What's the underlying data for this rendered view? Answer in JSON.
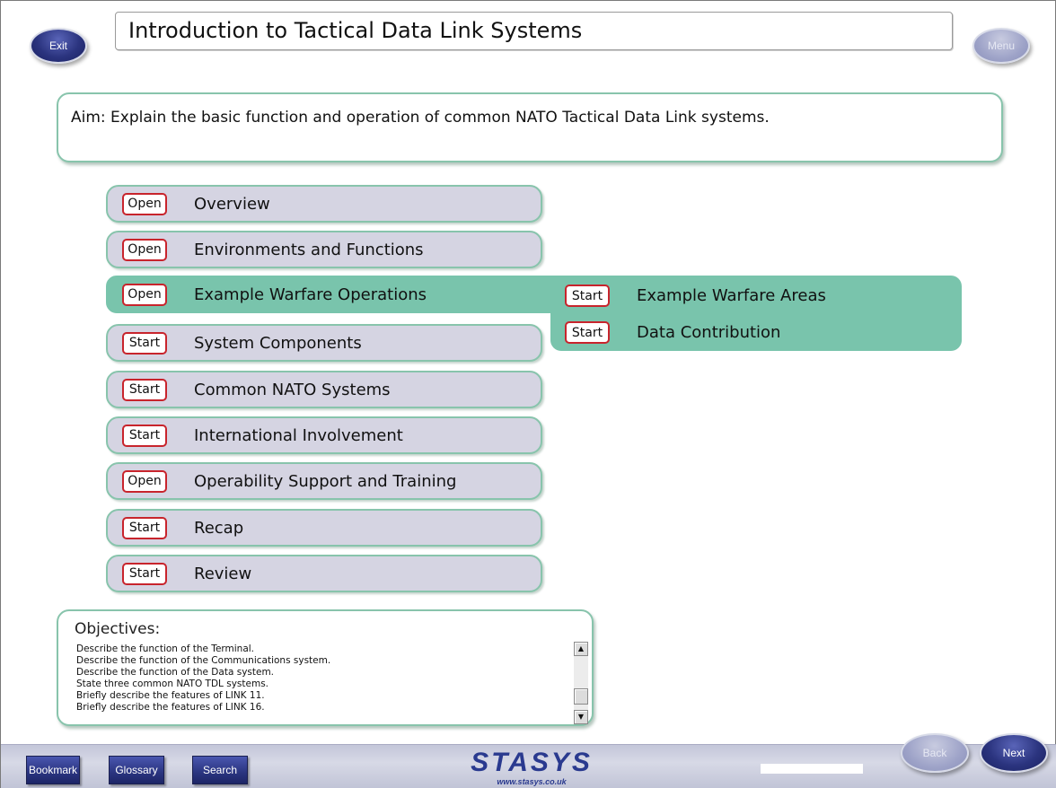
{
  "header": {
    "title": "Introduction to Tactical Data Link Systems",
    "exit_label": "Exit",
    "menu_label": "Menu"
  },
  "aim": {
    "text": "Aim: Explain the basic function and operation of common NATO Tactical Data Link systems."
  },
  "modules": [
    {
      "tag": "Open",
      "label": "Overview",
      "active": false
    },
    {
      "tag": "Open",
      "label": "Environments and Functions",
      "active": false
    },
    {
      "tag": "Open",
      "label": "Example Warfare Operations",
      "active": true
    },
    {
      "tag": "Start",
      "label": "System Components",
      "active": false
    },
    {
      "tag": "Start",
      "label": "Common NATO Systems",
      "active": false
    },
    {
      "tag": "Start",
      "label": "International Involvement",
      "active": false
    },
    {
      "tag": "Open",
      "label": "Operability Support and Training",
      "active": false
    },
    {
      "tag": "Start",
      "label": "Recap",
      "active": false
    },
    {
      "tag": "Start",
      "label": "Review",
      "active": false
    }
  ],
  "submenu": [
    {
      "tag": "Start",
      "label": "Example Warfare Areas"
    },
    {
      "tag": "Start",
      "label": "Data Contribution"
    }
  ],
  "objectives": {
    "title": "Objectives:",
    "items": [
      "Describe the function of the Terminal.",
      "Describe the function of the Communications system.",
      "Describe the function of the Data system.",
      "State three common NATO TDL systems.",
      "Briefly describe the features of LINK 11.",
      "Briefly describe the features of LINK 16."
    ],
    "scroll_up_glyph": "▲",
    "scroll_down_glyph": "▼"
  },
  "footer": {
    "bookmark_label": "Bookmark",
    "glossary_label": "Glossary",
    "search_label": "Search",
    "logo_text": "STASYS",
    "logo_url": "www.stasys.co.uk",
    "back_label": "Back",
    "next_label": "Next"
  },
  "colors": {
    "accent_green": "#79c4ac",
    "row_bg": "#d5d4e2",
    "tag_border": "#c8242c",
    "button_blue": "#2a347f"
  }
}
